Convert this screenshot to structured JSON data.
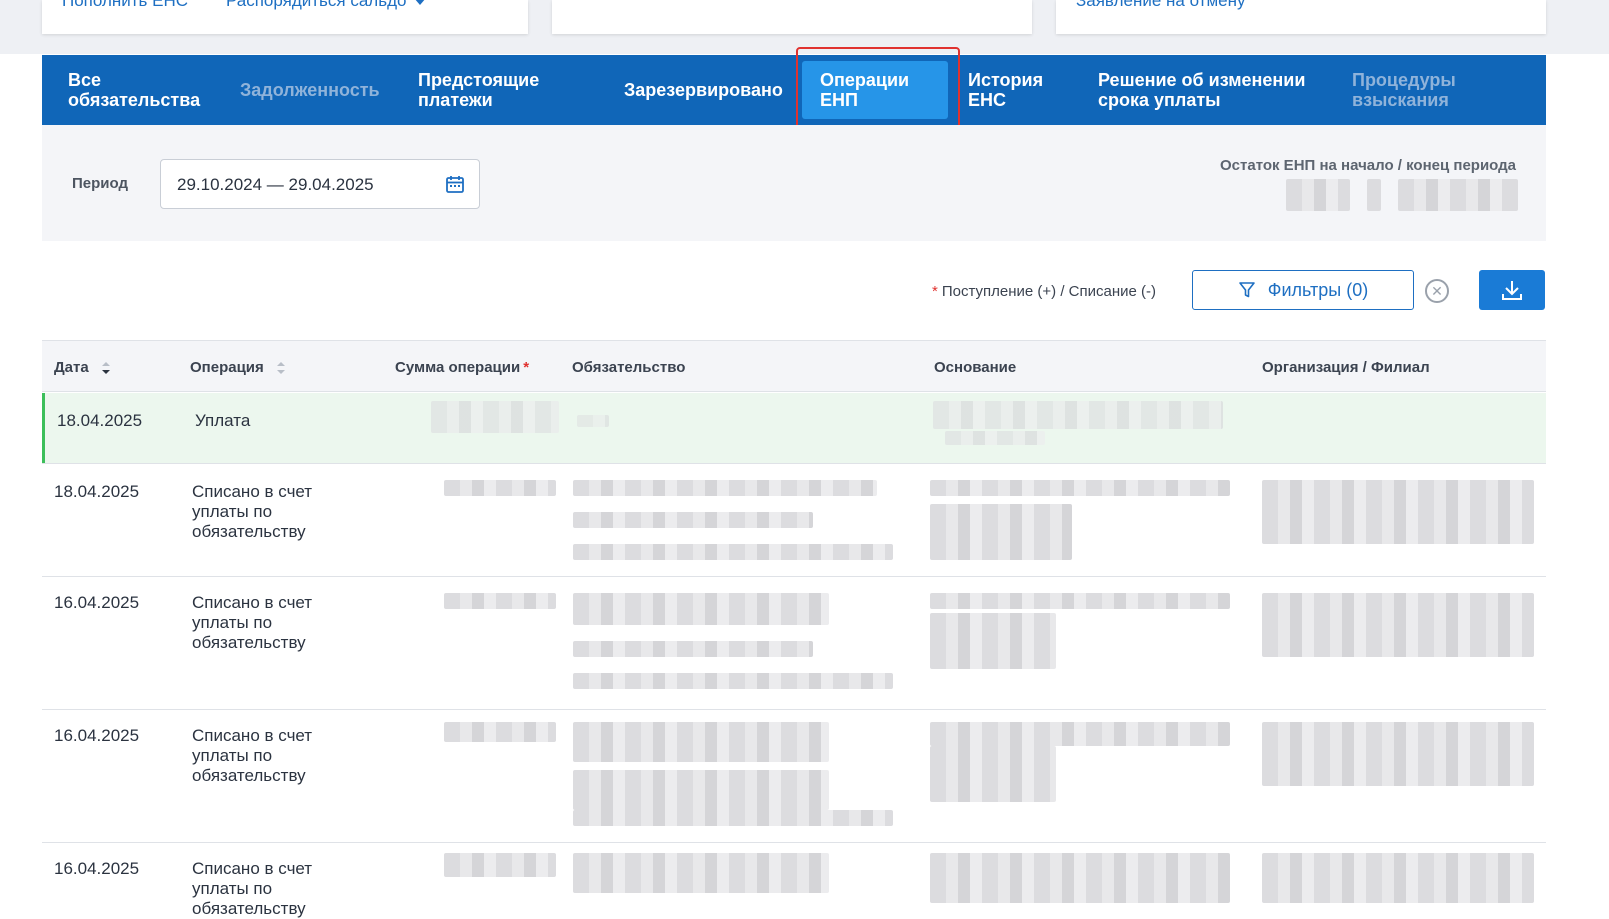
{
  "top_links": {
    "replenish": "Пополнить ЕНС",
    "dispose_balance": "Распорядиться сальдо",
    "cancel_statement": "Заявление на отмену"
  },
  "tabs": [
    {
      "label": "Все обязательства",
      "state": "normal"
    },
    {
      "label": "Задолженность",
      "state": "disabled"
    },
    {
      "label": "Предстоящие платежи",
      "state": "normal"
    },
    {
      "label": "Зарезервировано",
      "state": "normal"
    },
    {
      "label": "Операции ЕНП",
      "state": "active"
    },
    {
      "label": "История ЕНС",
      "state": "normal"
    },
    {
      "label": "Решение об изменении срока уплаты",
      "state": "normal"
    },
    {
      "label": "Процедуры взыскания",
      "state": "disabled"
    }
  ],
  "period": {
    "label": "Период",
    "range": "29.10.2024  —  29.04.2025",
    "balance_label": "Остаток ЕНП на начало / конец периода"
  },
  "toolbar": {
    "legend_star": "*",
    "legend_text": "Поступление (+) / Списание (-)",
    "filter_label": "Фильтры (0)"
  },
  "table": {
    "columns": {
      "date": "Дата",
      "operation": "Операция",
      "amount": "Сумма операции",
      "amount_star": "*",
      "obligation": "Обязательство",
      "basis": "Основание",
      "organization": "Организация / Филиал"
    },
    "rows": [
      {
        "date": "18.04.2025",
        "operation": "Уплата"
      },
      {
        "date": "18.04.2025",
        "operation": "Списано в счет уплаты по обязательству"
      },
      {
        "date": "16.04.2025",
        "operation": "Списано в счет уплаты по обязательству"
      },
      {
        "date": "16.04.2025",
        "operation": "Списано в счет уплаты по обязательству"
      },
      {
        "date": "16.04.2025",
        "operation": "Списано в счет уплаты по обязательству"
      }
    ]
  },
  "colors": {
    "tab_bar": "#1066b8",
    "tab_active": "#2695e8",
    "annotation_red": "#e0322f",
    "highlight_row": "#ecf7ee",
    "highlight_border": "#3cbf5a"
  }
}
